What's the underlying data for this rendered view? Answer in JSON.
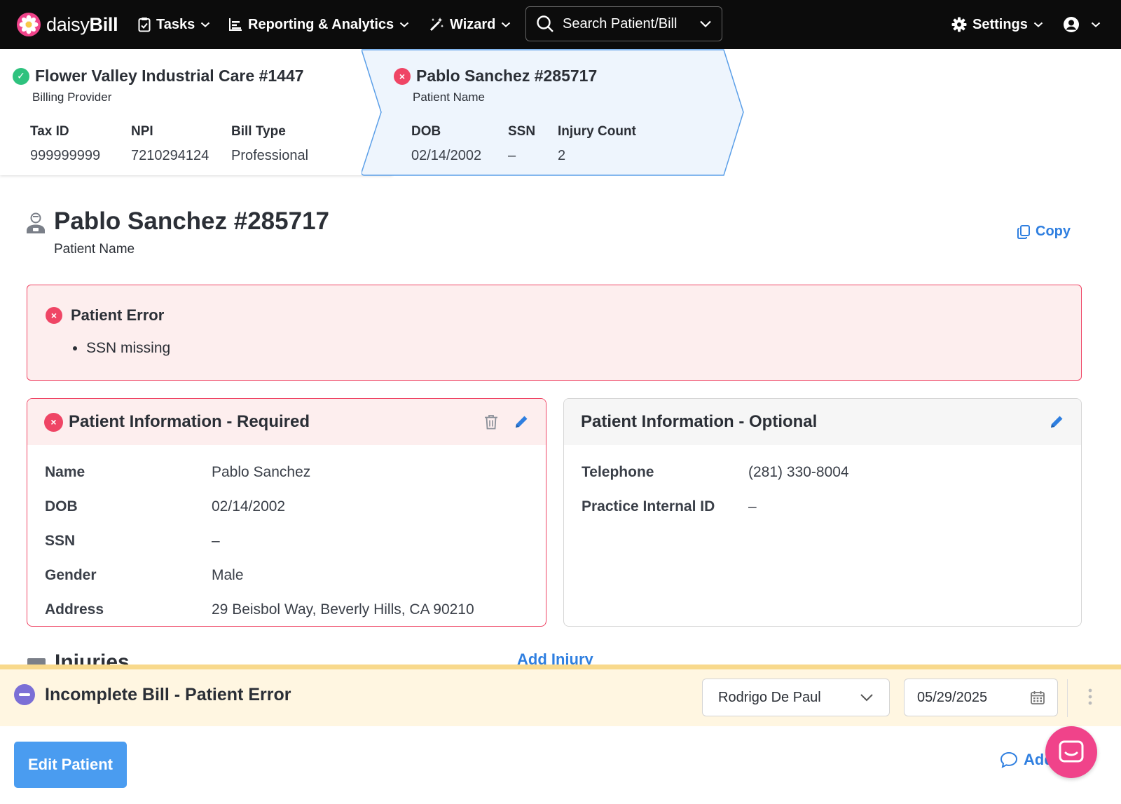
{
  "app": {
    "brand_light": "daisy",
    "brand_bold": "Bill"
  },
  "nav": {
    "tasks": "Tasks",
    "reporting": "Reporting & Analytics",
    "wizard": "Wizard",
    "search_label": "Search Patient/Bill",
    "settings": "Settings"
  },
  "breadcrumb": {
    "provider": {
      "title": "Flower Valley Industrial Care #1447",
      "subtitle": "Billing Provider",
      "fields": [
        {
          "key": "Tax ID",
          "value": "999999999"
        },
        {
          "key": "NPI",
          "value": "7210294124"
        },
        {
          "key": "Bill Type",
          "value": "Professional"
        }
      ]
    },
    "patient": {
      "title": "Pablo Sanchez #285717",
      "subtitle": "Patient Name",
      "fields": [
        {
          "key": "DOB",
          "value": "02/14/2002"
        },
        {
          "key": "SSN",
          "value": "–"
        },
        {
          "key": "Injury Count",
          "value": "2"
        }
      ]
    }
  },
  "patient_header": {
    "title": "Pablo Sanchez #285717",
    "subtitle": "Patient Name",
    "copy_label": "Copy"
  },
  "error_banner": {
    "title": "Patient Error",
    "items": [
      "SSN missing"
    ]
  },
  "required_card": {
    "title": "Patient Information - Required",
    "rows": [
      {
        "key": "Name",
        "value": "Pablo Sanchez"
      },
      {
        "key": "DOB",
        "value": "02/14/2002"
      },
      {
        "key": "SSN",
        "value": "–"
      },
      {
        "key": "Gender",
        "value": "Male"
      },
      {
        "key": "Address",
        "value": "29 Beisbol Way, Beverly Hills, CA 90210"
      }
    ]
  },
  "optional_card": {
    "title": "Patient Information - Optional",
    "rows": [
      {
        "key": "Telephone",
        "value": "(281) 330-8004"
      },
      {
        "key": "Practice Internal ID",
        "value": "–"
      }
    ]
  },
  "injuries": {
    "title": "Injuries",
    "add_label": "Add Injury"
  },
  "status_bar": {
    "status": "Incomplete Bill - Patient Error",
    "assignee": "Rodrigo De Paul",
    "date": "05/29/2025"
  },
  "footer": {
    "edit_button": "Edit Patient",
    "add_note": "Add Note"
  },
  "colors": {
    "nav_bg": "#0c0c0c",
    "error": "#ef4565",
    "success": "#2ec27e",
    "link": "#2f7fe0",
    "primary_button": "#4a9cf0",
    "status_bar": "#fff6e1",
    "chat": "#f0438a"
  },
  "icons": [
    "daisy-logo-icon",
    "clipboard-icon",
    "bar-chart-icon",
    "magic-wand-icon",
    "search-icon",
    "chevron-down-icon",
    "gear-icon",
    "user-circle-icon",
    "check-circle-icon",
    "error-circle-icon",
    "patient-icon",
    "copy-icon",
    "trash-icon",
    "pencil-icon",
    "minus-circle-icon",
    "calendar-icon",
    "kebab-icon",
    "comment-icon",
    "chat-icon"
  ]
}
